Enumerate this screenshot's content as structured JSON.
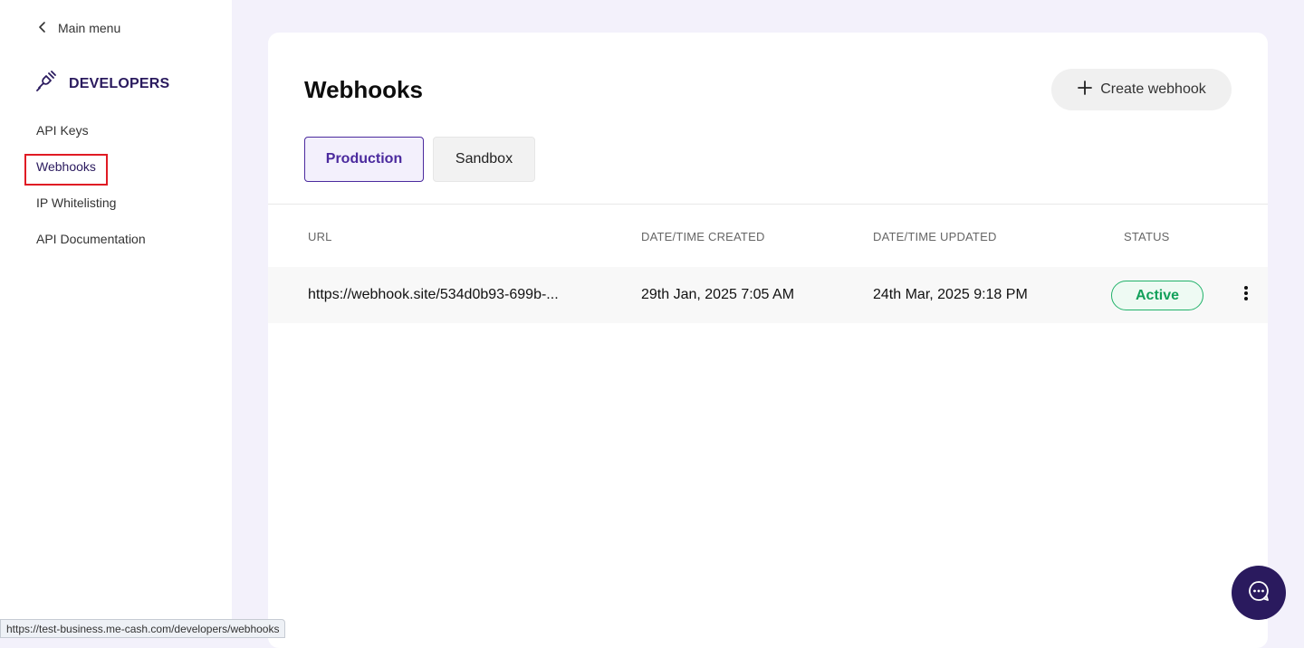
{
  "sidebar": {
    "back_label": "Main menu",
    "section_title": "DEVELOPERS",
    "items": [
      {
        "label": "API Keys"
      },
      {
        "label": "Webhooks"
      },
      {
        "label": "IP Whitelisting"
      },
      {
        "label": "API Documentation"
      }
    ]
  },
  "main": {
    "title": "Webhooks",
    "create_button": "Create webhook",
    "tabs": [
      {
        "label": "Production"
      },
      {
        "label": "Sandbox"
      }
    ],
    "table": {
      "headers": [
        "URL",
        "DATE/TIME CREATED",
        "DATE/TIME UPDATED",
        "STATUS"
      ],
      "rows": [
        {
          "url": "https://webhook.site/534d0b93-699b-...",
          "created": "29th Jan, 2025 7:05 AM",
          "updated": "24th Mar, 2025 9:18 PM",
          "status": "Active"
        }
      ]
    }
  },
  "status_bar_url": "https://test-business.me-cash.com/developers/webhooks",
  "colors": {
    "brand": "#2a1a5e",
    "accent": "#4b2a9e",
    "active_green": "#12a05a"
  }
}
